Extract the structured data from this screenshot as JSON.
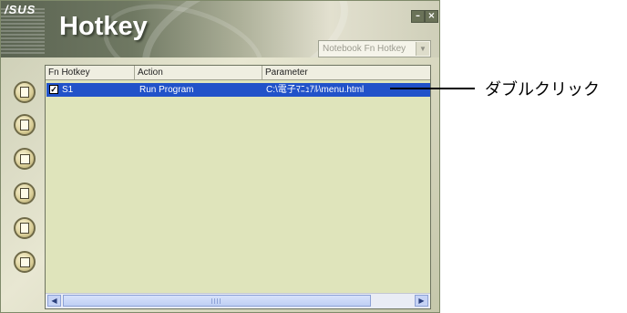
{
  "window": {
    "brand": "/SUS",
    "title": "Hotkey",
    "minimize_label": "–",
    "close_label": "×"
  },
  "dropdown": {
    "value": "Notebook Fn Hotkey",
    "arrow": "▼"
  },
  "sidebar": {
    "buttons": [
      {
        "name": "sidebar-button-1",
        "icon": "document-icon"
      },
      {
        "name": "sidebar-button-2",
        "icon": "document-edit-icon"
      },
      {
        "name": "sidebar-button-3",
        "icon": "documents-icon"
      },
      {
        "name": "sidebar-button-4",
        "icon": "document-list-icon"
      },
      {
        "name": "sidebar-button-5",
        "icon": "window-icon"
      },
      {
        "name": "sidebar-button-6",
        "icon": "grid-icon"
      }
    ]
  },
  "table": {
    "columns": [
      "Fn Hotkey",
      "Action",
      "Parameter"
    ],
    "rows": [
      {
        "checked": true,
        "check_mark": "✓",
        "hotkey": "S1",
        "action": "Run Program",
        "parameter": "C:\\電子ﾏﾆｭｱﾙ\\menu.html"
      }
    ]
  },
  "scrollbar": {
    "left_arrow": "◀",
    "right_arrow": "▶"
  },
  "annotation": {
    "text": "ダブルクリック"
  },
  "colors": {
    "selection": "#2152c9",
    "list_background": "#dfe4bb",
    "scrollbar": "#c6d3f5"
  }
}
